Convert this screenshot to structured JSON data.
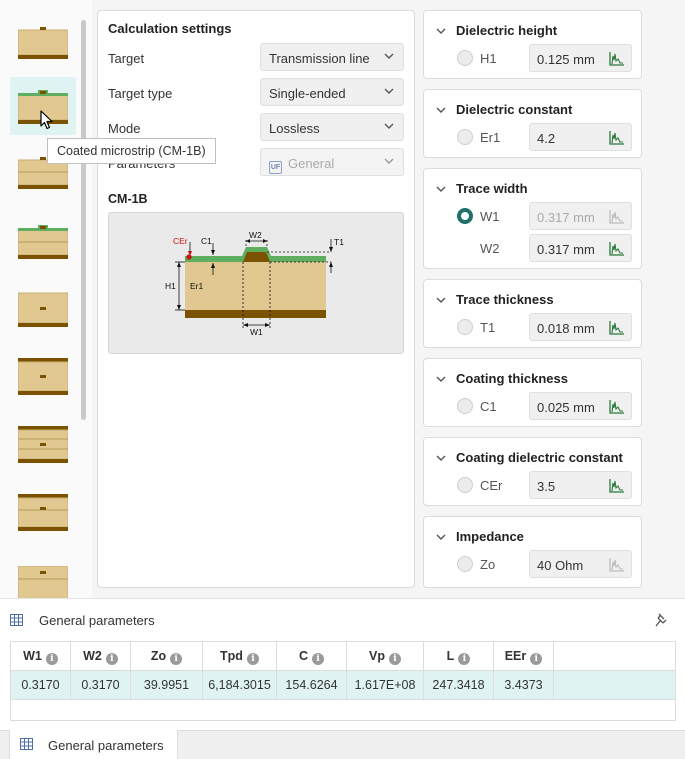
{
  "tooltip": "Coated microstrip (CM-1B)",
  "calc": {
    "title": "Calculation settings",
    "rows": [
      {
        "label": "Target",
        "value": "Transmission line"
      },
      {
        "label": "Target type",
        "value": "Single-ended"
      },
      {
        "label": "Mode",
        "value": "Lossless"
      },
      {
        "label": "Parameters",
        "value": "General"
      }
    ],
    "model_title": "CM-1B"
  },
  "diagram": {
    "labels": {
      "cer": "CEr",
      "c1": "C1",
      "w2": "W2",
      "t1": "T1",
      "h1": "H1",
      "er1": "Er1",
      "w1": "W1"
    }
  },
  "cards": [
    {
      "title": "Dielectric height",
      "params": [
        {
          "label": "H1",
          "value": "0.125 mm",
          "selected": false,
          "disabled": false
        }
      ]
    },
    {
      "title": "Dielectric constant",
      "params": [
        {
          "label": "Er1",
          "value": "4.2",
          "selected": false,
          "disabled": false
        }
      ]
    },
    {
      "title": "Trace width",
      "params": [
        {
          "label": "W1",
          "value": "0.317 mm",
          "selected": true,
          "disabled": true
        },
        {
          "label": "W2",
          "value": "0.317 mm",
          "selected": false,
          "disabled": false
        }
      ]
    },
    {
      "title": "Trace thickness",
      "params": [
        {
          "label": "T1",
          "value": "0.018 mm",
          "selected": false,
          "disabled": false
        }
      ]
    },
    {
      "title": "Coating thickness",
      "params": [
        {
          "label": "C1",
          "value": "0.025 mm",
          "selected": false,
          "disabled": false
        }
      ]
    },
    {
      "title": "Coating dielectric constant",
      "params": [
        {
          "label": "CEr",
          "value": "3.5",
          "selected": false,
          "disabled": false
        }
      ]
    },
    {
      "title": "Impedance",
      "params": [
        {
          "label": "Zo",
          "value": "40 Ohm",
          "selected": false,
          "disabled": true
        }
      ]
    }
  ],
  "results": {
    "title": "General parameters",
    "columns": [
      "W1",
      "W2",
      "Zo",
      "Tpd",
      "C",
      "Vp",
      "L",
      "EEr"
    ],
    "row": [
      "0.3170",
      "0.3170",
      "39.9951",
      "6,184.3015",
      "154.6264",
      "1.617E+08",
      "247.3418",
      "3.4373"
    ]
  },
  "bottom_tab": "General parameters",
  "colors": {
    "accent": "#20706a",
    "selected_row": "#dff4f2",
    "trace_green": "#5fae5f",
    "board": "#e0c890",
    "copper": "#7a5200"
  }
}
